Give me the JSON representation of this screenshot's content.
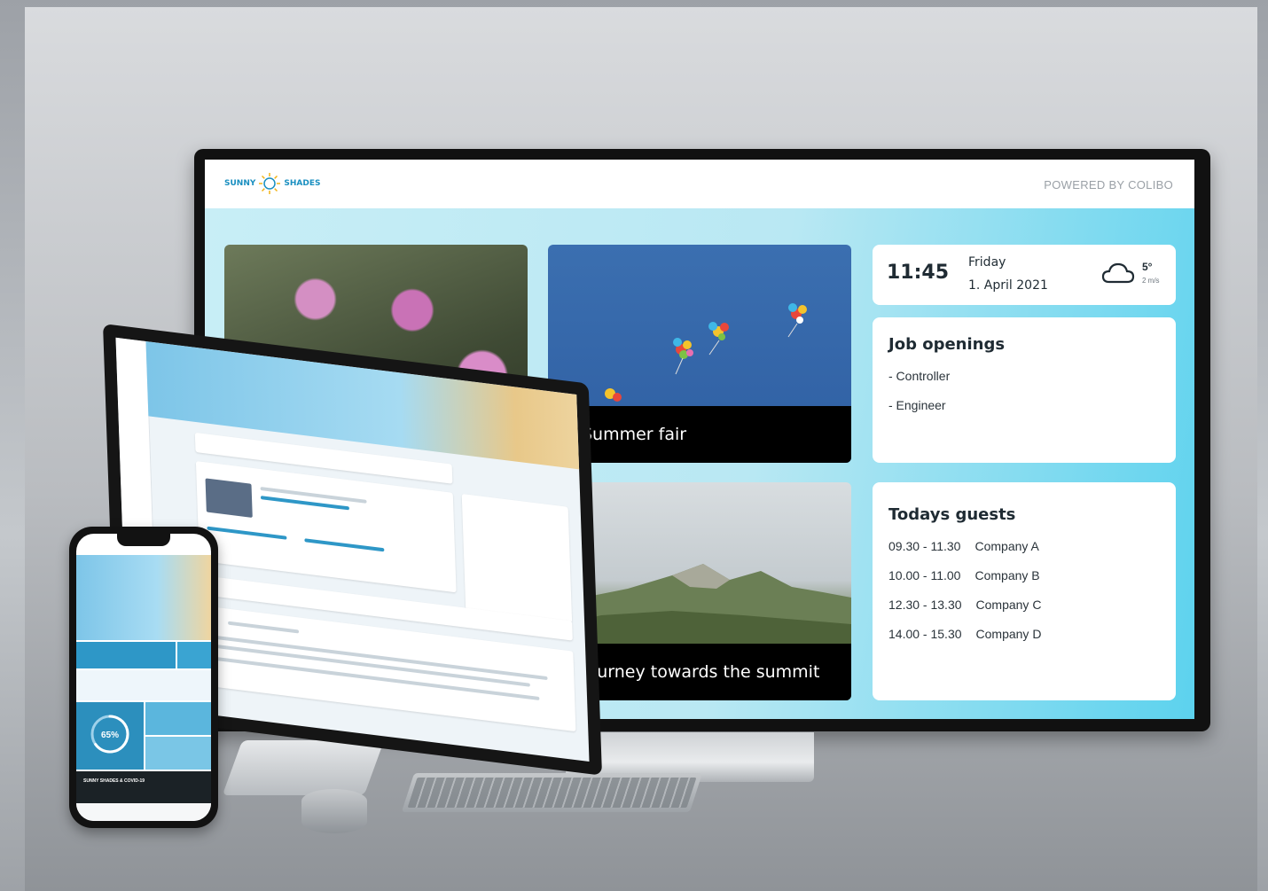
{
  "monitor": {
    "brand_left": "SUNNY",
    "brand_right": "SHADES",
    "powered_by": "POWERED BY COLIBO",
    "tiles": [
      {
        "caption": "Summer fair"
      },
      {
        "caption": "Journey towards the summit"
      }
    ],
    "clock": {
      "time": "11:45",
      "day": "Friday",
      "date": "1. April 2021",
      "temperature": "5°",
      "wind": "2 m/s",
      "weather_icon": "cloud-icon"
    },
    "jobs": {
      "title": "Job openings",
      "items": [
        "- Controller",
        "- Engineer"
      ]
    },
    "guests": {
      "title": "Todays guests",
      "rows": [
        {
          "time": "09.30 - 11.30",
          "company": "Company A"
        },
        {
          "time": "10.00 - 11.00",
          "company": "Company B"
        },
        {
          "time": "12.30 - 13.30",
          "company": "Company C"
        },
        {
          "time": "14.00 - 15.30",
          "company": "Company D"
        }
      ]
    }
  },
  "phone": {
    "progress_label": "65%",
    "progress_fraction": 0.65,
    "banner": "SUNNY SHADES & COVID-19"
  },
  "colors": {
    "accent": "#1a8fc0",
    "screen_bg": "#b9e8f3",
    "caption_bg": "#000000"
  }
}
